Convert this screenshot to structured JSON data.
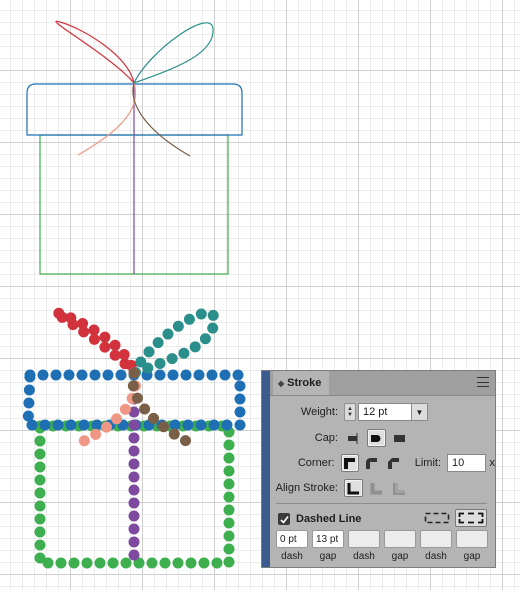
{
  "colors": {
    "bow_left": "#d2323c",
    "bow_right": "#2a8f8a",
    "lid": "#1f6fb5",
    "box": "#3daf4e",
    "ribbon": "#7e4aa0",
    "tail_left": "#ef9685",
    "tail_right": "#7a5f48",
    "panel_bg": "#b4b4b4",
    "panel_edge": "#3b5c8f"
  },
  "stroke_panel": {
    "tab_title": "Stroke",
    "menu_icon": "hamburger-icon",
    "weight": {
      "label": "Weight:",
      "value": "12 pt"
    },
    "cap": {
      "label": "Cap:",
      "options": [
        "butt-cap",
        "round-cap",
        "projecting-cap"
      ],
      "selected": "round-cap"
    },
    "corner": {
      "label": "Corner:",
      "options": [
        "miter-join",
        "round-join",
        "bevel-join"
      ],
      "selected": "miter-join"
    },
    "limit": {
      "label": "Limit:",
      "value": "10",
      "suffix": "x"
    },
    "align_stroke": {
      "label": "Align Stroke:",
      "selected": "center"
    },
    "dashed_line": {
      "label": "Dashed Line",
      "checked": true,
      "align_modes": [
        "preserve-exact-dash",
        "align-dashes-to-corners"
      ],
      "selected_mode": "align-dashes-to-corners"
    },
    "dash_gap": [
      {
        "value": "0 pt",
        "caption": "dash"
      },
      {
        "value": "13 pt",
        "caption": "gap"
      },
      {
        "value": "",
        "caption": "dash"
      },
      {
        "value": "",
        "caption": "gap"
      },
      {
        "value": "",
        "caption": "dash"
      },
      {
        "value": "",
        "caption": "gap"
      }
    ]
  }
}
